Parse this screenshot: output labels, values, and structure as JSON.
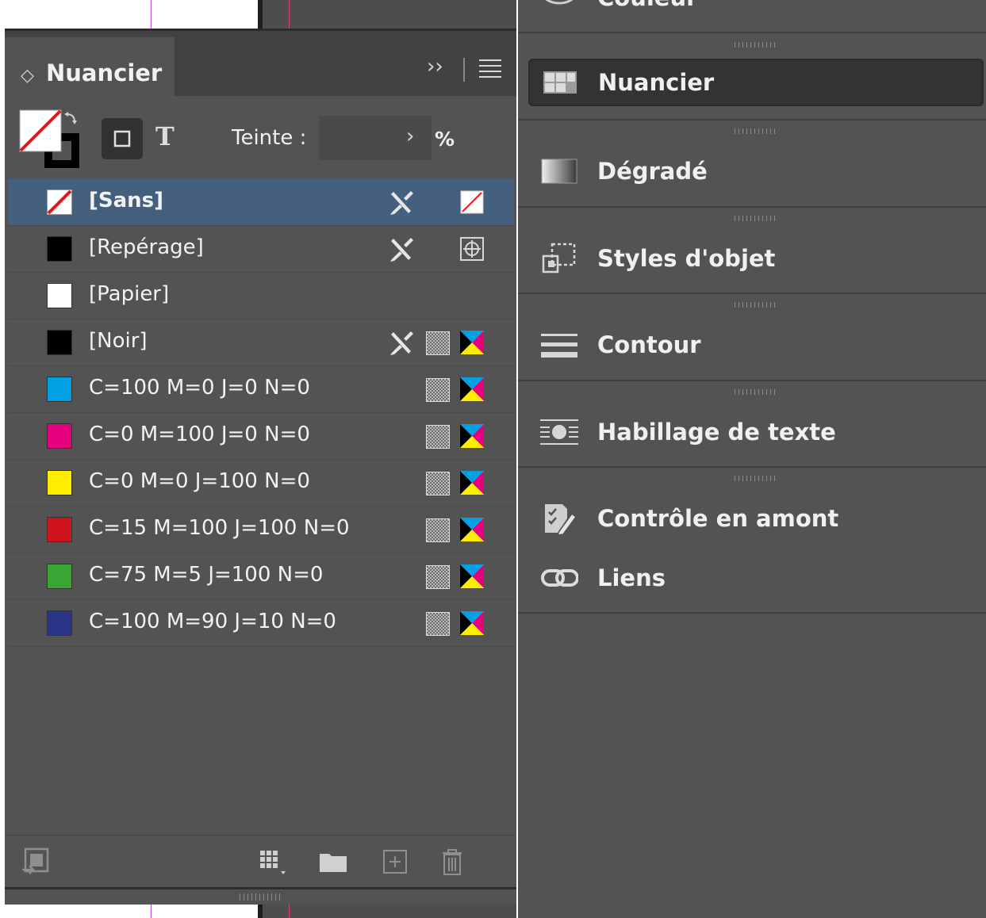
{
  "panel": {
    "title": "Nuancier",
    "tint_label": "Teinte :",
    "tint_value": "",
    "tint_unit": "%",
    "text_mode": "T"
  },
  "swatches": [
    {
      "label": "[Sans]",
      "color": "none",
      "selected": true,
      "locked": true,
      "mode": "none"
    },
    {
      "label": "[Repérage]",
      "color": "#000000",
      "locked": true,
      "mode": "registration"
    },
    {
      "label": "[Papier]",
      "color": "#ffffff",
      "locked": false,
      "mode": ""
    },
    {
      "label": "[Noir]",
      "color": "#000000",
      "locked": true,
      "mode": "cmyk"
    },
    {
      "label": "C=100 M=0 J=0 N=0",
      "color": "#00a0e3",
      "locked": false,
      "mode": "cmyk"
    },
    {
      "label": "C=0 M=100 J=0 N=0",
      "color": "#e5007e",
      "locked": false,
      "mode": "cmyk"
    },
    {
      "label": "C=0 M=0 J=100 N=0",
      "color": "#ffed00",
      "locked": false,
      "mode": "cmyk"
    },
    {
      "label": "C=15 M=100 J=100 N=0",
      "color": "#d0141b",
      "locked": false,
      "mode": "cmyk"
    },
    {
      "label": "C=75 M=5 J=100 N=0",
      "color": "#3aa535",
      "locked": false,
      "mode": "cmyk"
    },
    {
      "label": "C=100 M=90 J=10 N=0",
      "color": "#2a3588",
      "locked": false,
      "mode": "cmyk"
    }
  ],
  "dock": {
    "partial_top": "Couleur",
    "items": [
      {
        "label": "Nuancier",
        "icon": "swatches-icon"
      },
      {
        "label": "Dégradé",
        "icon": "gradient-icon"
      },
      {
        "label": "Styles d'objet",
        "icon": "object-styles-icon"
      },
      {
        "label": "Contour",
        "icon": "stroke-icon"
      },
      {
        "label": "Habillage de texte",
        "icon": "text-wrap-icon"
      },
      {
        "label": "Contrôle en amont",
        "icon": "preflight-icon"
      },
      {
        "label": "Liens",
        "icon": "links-icon"
      }
    ]
  },
  "colors": {
    "panel_bg": "#535353",
    "selected_row": "#45607f",
    "dock_bg": "#535353"
  }
}
